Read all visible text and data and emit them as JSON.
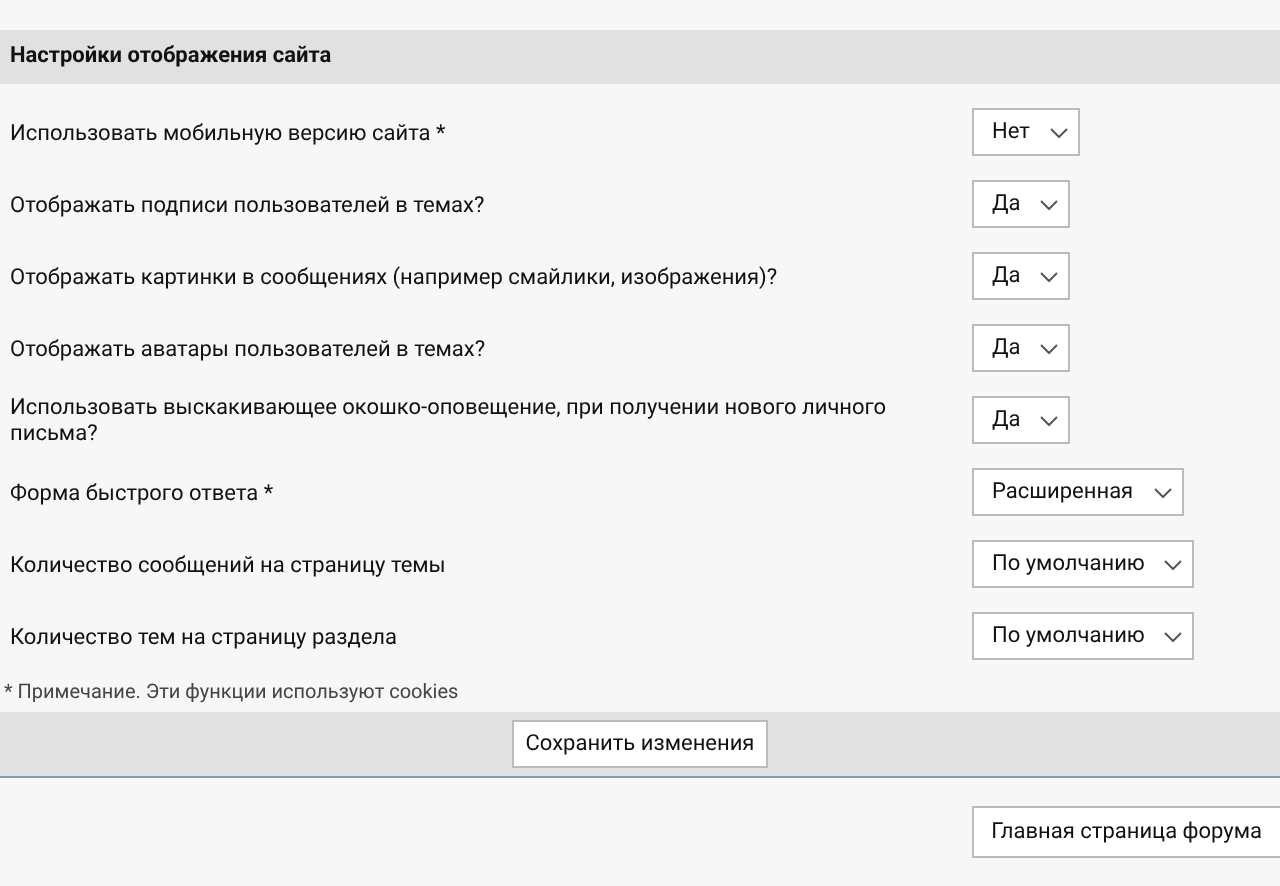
{
  "section_title": "Настройки отображения сайта",
  "settings": [
    {
      "label": "Использовать мобильную версию сайта *",
      "value": "Нет"
    },
    {
      "label": "Отображать подписи пользователей в темах?",
      "value": "Да"
    },
    {
      "label": "Отображать картинки в сообщениях (например смайлики, изображения)?",
      "value": "Да"
    },
    {
      "label": "Отображать аватары пользователей в темах?",
      "value": "Да"
    },
    {
      "label": "Использовать выскакивающее окошко-оповещение, при получении нового личного письма?",
      "value": "Да"
    },
    {
      "label": "Форма быстрого ответа *",
      "value": "Расширенная"
    },
    {
      "label": "Количество сообщений на страницу темы",
      "value": "По умолчанию"
    },
    {
      "label": "Количество тем на страницу раздела",
      "value": "По умолчанию"
    }
  ],
  "note": "* Примечание. Эти функции используют cookies",
  "save_button": "Сохранить изменения",
  "forum_home_button": "Главная страница форума"
}
